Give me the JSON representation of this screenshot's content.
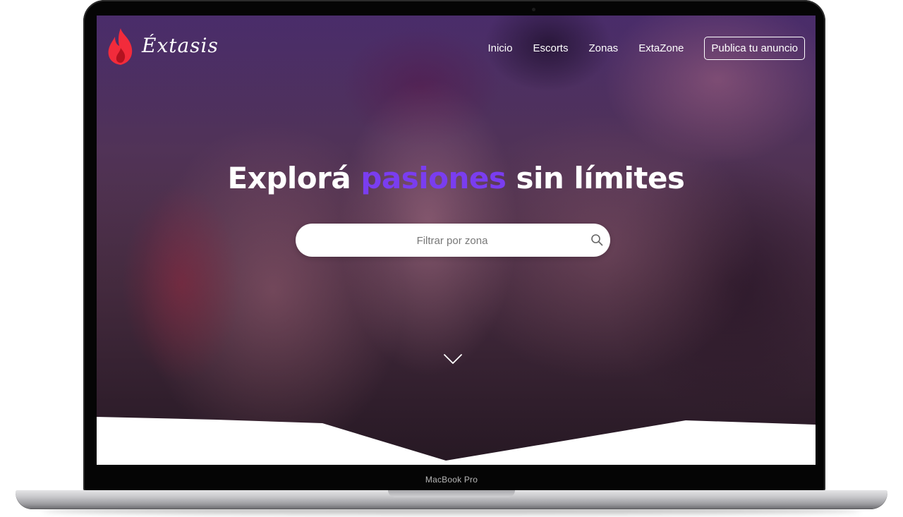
{
  "device": {
    "label": "MacBook Pro"
  },
  "brand": {
    "name": "Éxtasis",
    "flame_color": "#f22b3b"
  },
  "nav": {
    "items": [
      {
        "label": "Inicio"
      },
      {
        "label": "Escorts"
      },
      {
        "label": "Zonas"
      },
      {
        "label": "ExtaZone"
      }
    ],
    "cta_label": "Publica tu anuncio"
  },
  "hero": {
    "headline_before": "Explorá ",
    "headline_accent": "pasiones",
    "headline_after": " sin límites",
    "accent_color": "#7a3df0"
  },
  "search": {
    "placeholder": "Filtrar por zona",
    "value": ""
  },
  "icons": {
    "logo": "flame-icon",
    "search": "search-icon",
    "scroll": "chevron-down-icon"
  }
}
